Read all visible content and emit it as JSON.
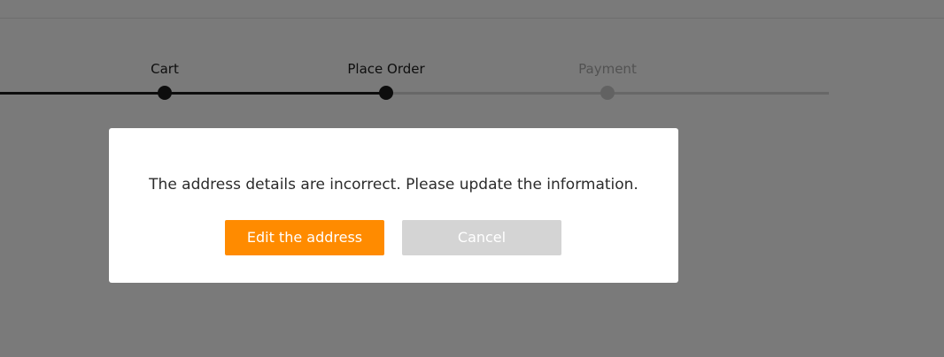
{
  "stepper": {
    "steps": [
      {
        "label": "Cart",
        "state": "done"
      },
      {
        "label": "Place Order",
        "state": "current"
      },
      {
        "label": "Payment",
        "state": "pending"
      }
    ]
  },
  "dialog": {
    "message": "The address details are incorrect. Please update the information.",
    "primary_label": "Edit the address",
    "secondary_label": "Cancel"
  },
  "colors": {
    "accent": "#ff8b00",
    "disabled_button": "#d4d4d4",
    "step_done": "#1b1b1b",
    "step_pending": "#c4c4c4"
  }
}
